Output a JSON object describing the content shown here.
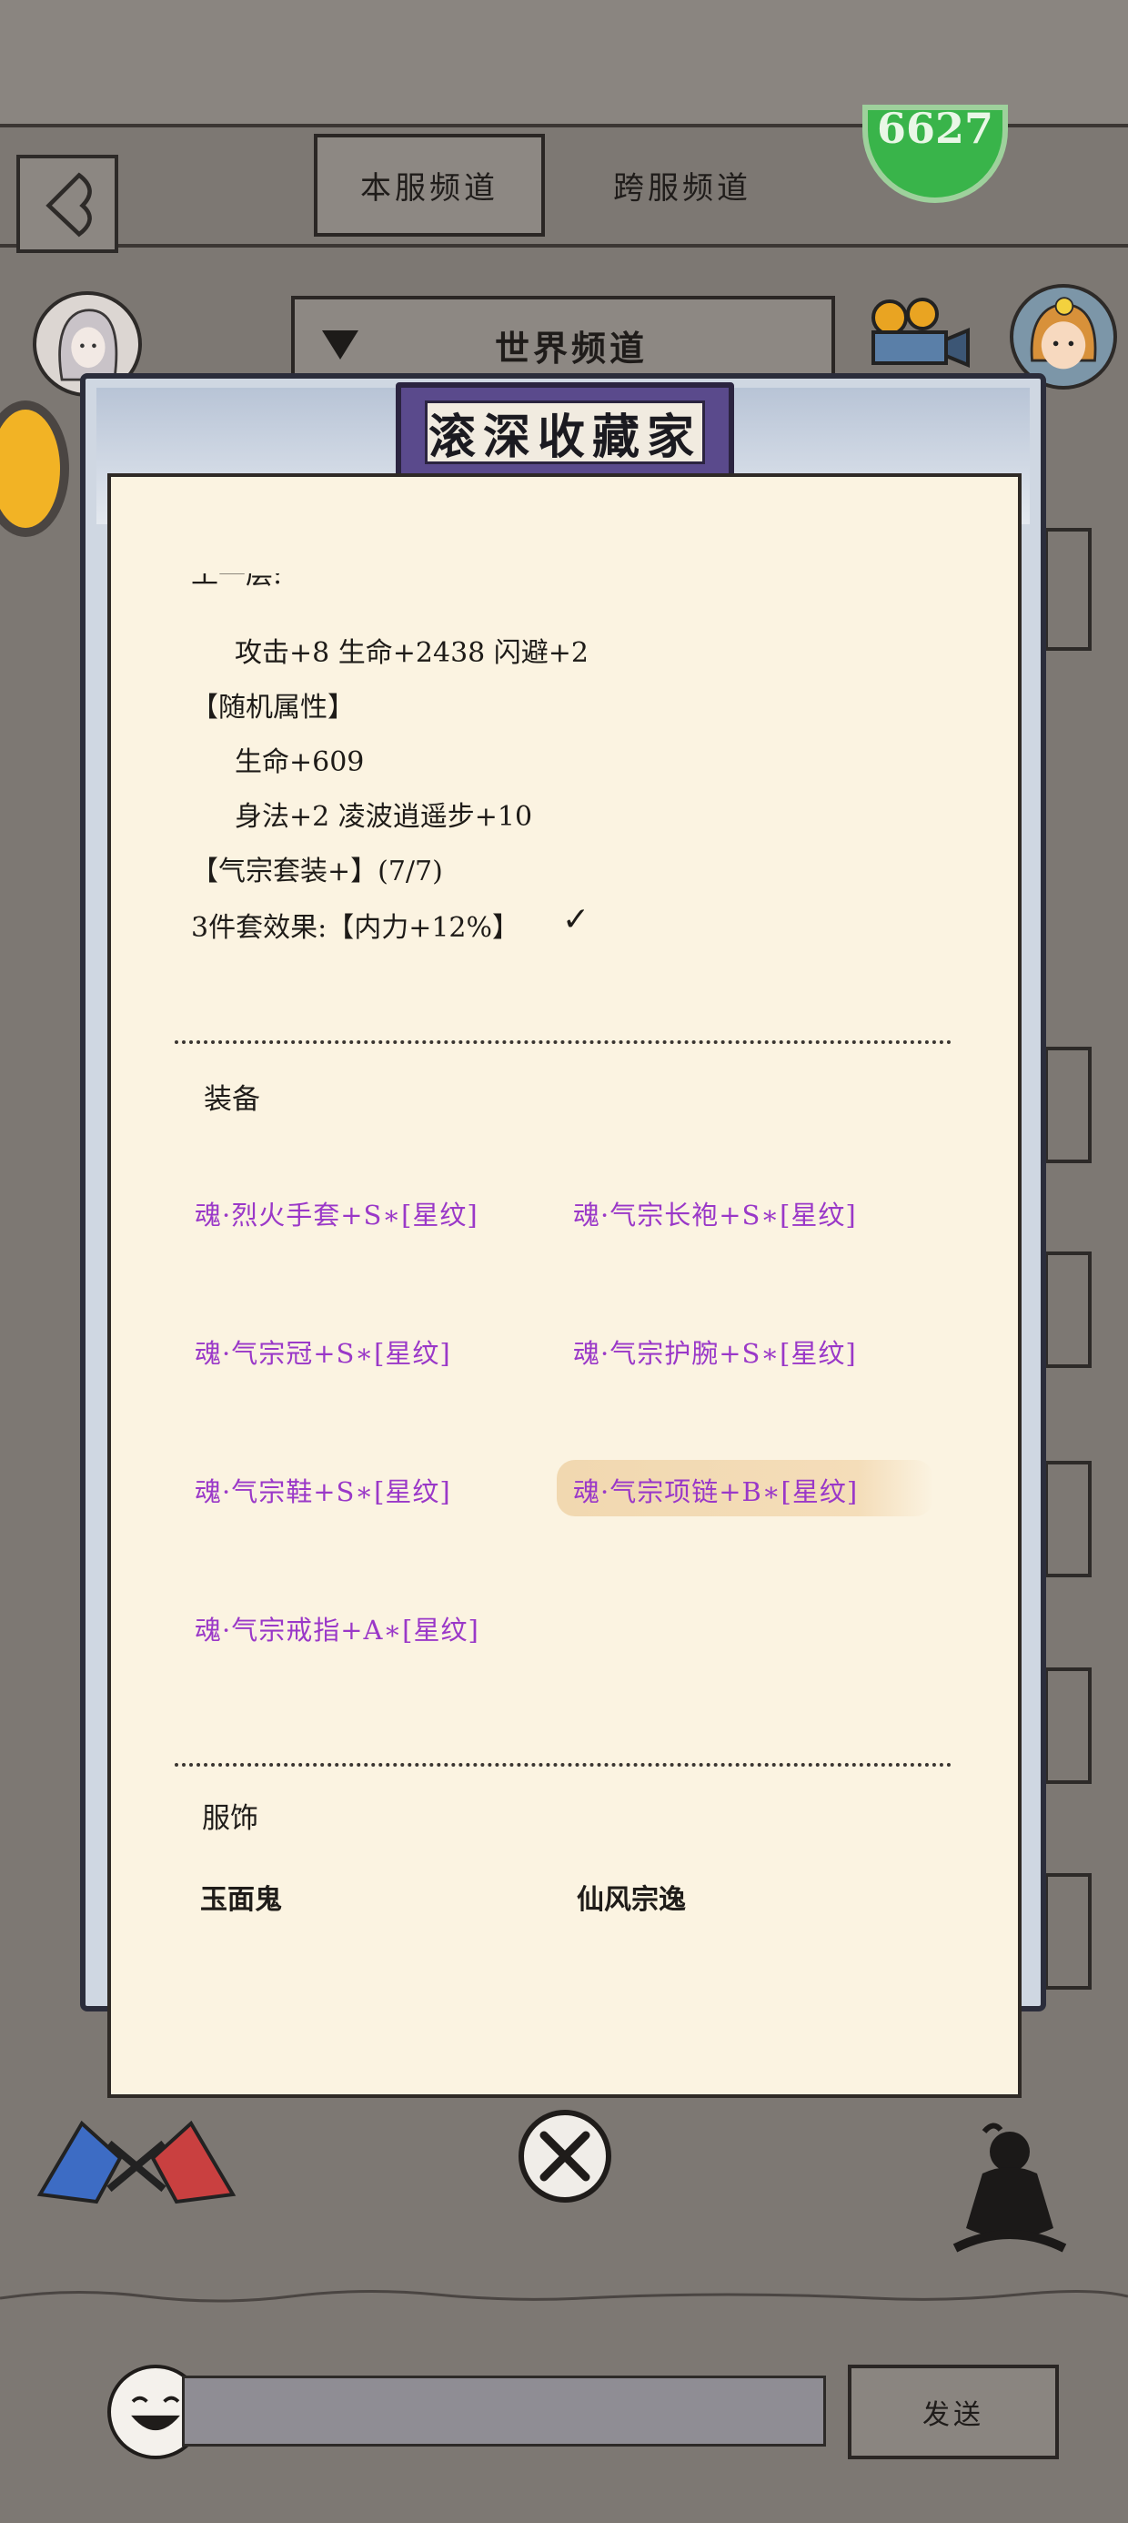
{
  "header": {
    "tabs": [
      {
        "label": "本服频道"
      },
      {
        "label": "跨服频道"
      }
    ],
    "badge_text": "6627",
    "channel_select": "世界频道"
  },
  "modal": {
    "title": "滚深收藏家",
    "attributes": {
      "partial_line": "工一层:",
      "layer_stats": "攻击+8 生命+2438 闪避+2",
      "random_header": "【随机属性】",
      "random_1": "生命+609",
      "random_2": "身法+2 凌波逍遥步+10",
      "set_name": "【气宗套装+】(7/7)",
      "set_effect": "3件套效果:【内力+12%】",
      "set_check": "✓"
    },
    "equipment": {
      "label": "装备",
      "items": [
        "魂·烈火手套+S∗[星纹]",
        "魂·气宗长袍+S∗[星纹]",
        "魂·气宗冠+S∗[星纹]",
        "魂·气宗护腕+S∗[星纹]",
        "魂·气宗鞋+S∗[星纹]",
        "魂·气宗项链+B∗[星纹]",
        "魂·气宗戒指+A∗[星纹]"
      ]
    },
    "costume": {
      "label": "服饰",
      "items": [
        "玉面鬼",
        "仙风宗逸"
      ]
    }
  },
  "footer": {
    "send_label": "发送"
  },
  "colors": {
    "background": "#7d7873",
    "paper": "#fbf3e1",
    "equipment_text": "#9a38c8",
    "title_plaque": "#5a4a8c"
  }
}
